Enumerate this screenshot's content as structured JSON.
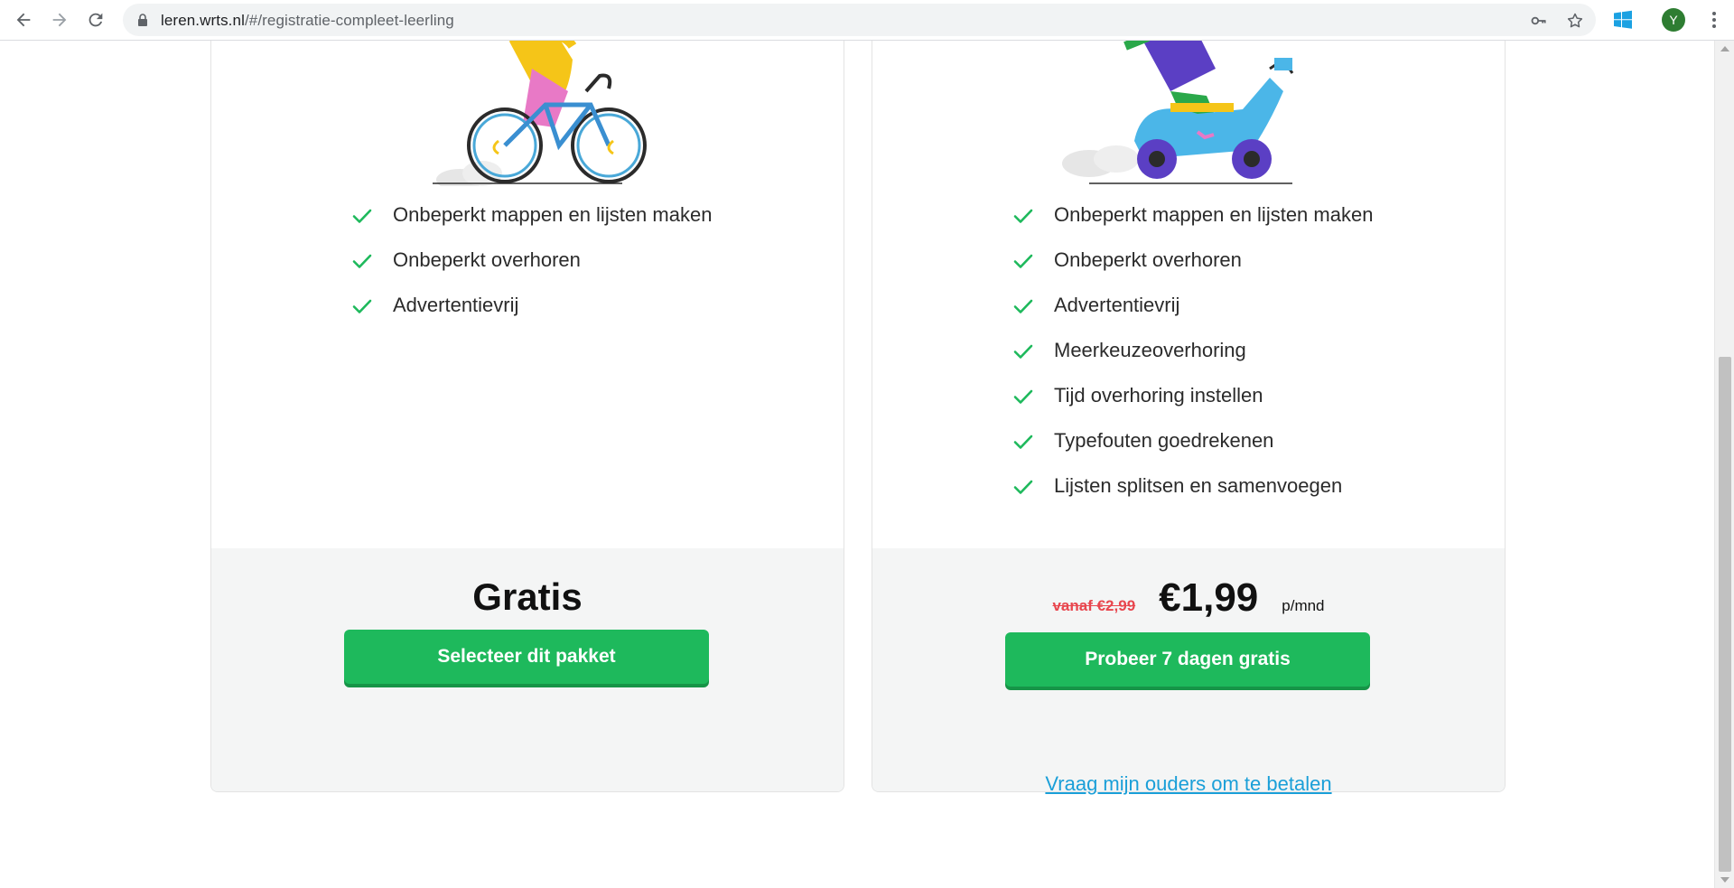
{
  "browser": {
    "url_host": "leren.wrts.nl",
    "url_path": "/#/registratie-compleet-leerling",
    "avatar_initial": "Y",
    "icons": [
      "back-icon",
      "forward-icon",
      "reload-icon",
      "lock-icon",
      "key-icon",
      "star-icon",
      "windows-extension-icon",
      "menu-icon"
    ]
  },
  "plans": {
    "free": {
      "features": [
        "Onbeperkt mappen en lijsten maken",
        "Onbeperkt overhoren",
        "Advertentievrij"
      ],
      "price": "Gratis",
      "cta": "Selecteer dit pakket"
    },
    "premium": {
      "features": [
        "Onbeperkt mappen en lijsten maken",
        "Onbeperkt overhoren",
        "Advertentievrij",
        "Meerkeuzeoverhoring",
        "Tijd overhoring instellen",
        "Typefouten goedrekenen",
        "Lijsten splitsen en samenvoegen"
      ],
      "old_price": "vanaf €2,99",
      "price": "€1,99",
      "per": "p/mnd",
      "cta": "Probeer 7 dagen gratis"
    }
  },
  "parents_link": "Vraag mijn ouders om te betalen",
  "colors": {
    "accent_green": "#1eb95c",
    "check_green": "#1eb95c",
    "link_blue": "#1a9fd8",
    "old_price_red": "#e8464e"
  }
}
